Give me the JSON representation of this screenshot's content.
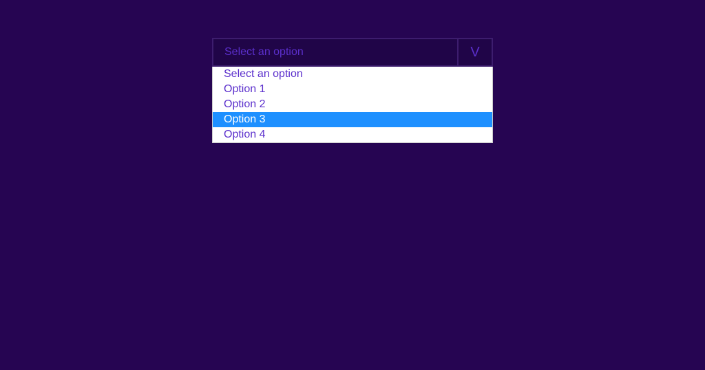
{
  "dropdown": {
    "selected_label": "Select an option",
    "arrow_glyph": "V",
    "options": [
      {
        "label": "Select an option",
        "highlighted": false
      },
      {
        "label": "Option 1",
        "highlighted": false
      },
      {
        "label": "Option 2",
        "highlighted": false
      },
      {
        "label": "Option 3",
        "highlighted": true
      },
      {
        "label": "Option 4",
        "highlighted": false
      }
    ]
  },
  "colors": {
    "background": "#260552",
    "header_bg": "#200548",
    "header_border": "#3d1d6e",
    "text_purple": "#5b2fcc",
    "highlight_bg": "#1e90ff",
    "highlight_text": "#ffffff",
    "list_bg": "#ffffff"
  }
}
